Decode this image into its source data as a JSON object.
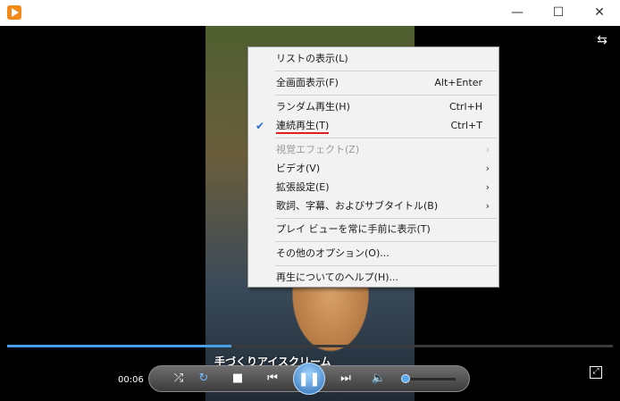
{
  "titlebar": {
    "minimize_glyph": "—",
    "maximize_glyph": "☐",
    "close_glyph": "✕",
    "icon": "media-player-icon"
  },
  "context_menu": {
    "items": [
      {
        "label": "リストの表示(L)",
        "shortcut": "",
        "has_submenu": false,
        "disabled": false,
        "checked": false
      },
      {
        "label": "全画面表示(F)",
        "shortcut": "Alt+Enter",
        "has_submenu": false,
        "disabled": false,
        "checked": false
      },
      {
        "label": "ランダム再生(H)",
        "shortcut": "Ctrl+H",
        "has_submenu": false,
        "disabled": false,
        "checked": false
      },
      {
        "label": "連続再生(T)",
        "shortcut": "Ctrl+T",
        "has_submenu": false,
        "disabled": false,
        "checked": true
      },
      {
        "label": "視覚エフェクト(Z)",
        "shortcut": "",
        "has_submenu": true,
        "disabled": true,
        "checked": false
      },
      {
        "label": "ビデオ(V)",
        "shortcut": "",
        "has_submenu": true,
        "disabled": false,
        "checked": false
      },
      {
        "label": "拡張設定(E)",
        "shortcut": "",
        "has_submenu": true,
        "disabled": false,
        "checked": false
      },
      {
        "label": "歌詞、字幕、およびサブタイトル(B)",
        "shortcut": "",
        "has_submenu": true,
        "disabled": false,
        "checked": false
      },
      {
        "label": "プレイ ビューを常に手前に表示(T)",
        "shortcut": "",
        "has_submenu": false,
        "disabled": false,
        "checked": false
      },
      {
        "label": "その他のオプション(O)...",
        "shortcut": "",
        "has_submenu": false,
        "disabled": false,
        "checked": false
      },
      {
        "label": "再生についてのヘルプ(H)...",
        "shortcut": "",
        "has_submenu": false,
        "disabled": false,
        "checked": false
      }
    ],
    "check_glyph": "✔",
    "arrow_glyph": "›"
  },
  "player": {
    "clip_title": "手づくりアイスクリーム",
    "elapsed": "00:06",
    "progress_fraction": 0.37,
    "volume_fraction": 0.05,
    "accent_color": "#4aa0e8"
  },
  "controls": {
    "shuffle_glyph": "⤮",
    "repeat_glyph": "↻",
    "stop_glyph": "■",
    "prev_glyph": "⏮",
    "play_pause_glyph": "❚❚",
    "next_glyph": "⏭",
    "mute_glyph": "🔈"
  },
  "view": {
    "switch_layout_glyph": "⇆",
    "fullscreen_glyph": "⤢"
  }
}
